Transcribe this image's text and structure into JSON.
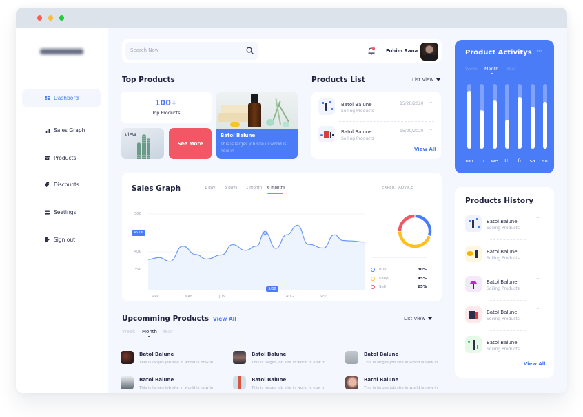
{
  "window": {
    "controls": [
      {
        "name": "close",
        "color": "#fd5f57"
      },
      {
        "name": "minimize",
        "color": "#febc2e"
      },
      {
        "name": "maximize",
        "color": "#28c840"
      }
    ]
  },
  "sidebar": {
    "items": [
      {
        "label": "Dashbord",
        "icon": "grid-icon",
        "active": true
      },
      {
        "label": "Sales Graph",
        "icon": "bar-chart-icon",
        "active": false
      },
      {
        "label": "Products",
        "icon": "box-icon",
        "active": false
      },
      {
        "label": "Discounts",
        "icon": "tag-icon",
        "active": false
      },
      {
        "label": "Seetings",
        "icon": "settings-icon",
        "active": false
      },
      {
        "label": "Sign out",
        "icon": "sign-out-icon",
        "active": false
      }
    ]
  },
  "topbar": {
    "search_placeholder": "Search Now",
    "user_name": "Fohim Rana",
    "notification_dot_color": "#f25766"
  },
  "top_products": {
    "title": "Top Products",
    "count": "100+",
    "count_label": "Top Products",
    "view_label": "View",
    "see_more_label": "See More",
    "feature": {
      "title": "Batol Balune",
      "desc": "This is larges job site in world is now in"
    }
  },
  "products_list": {
    "title": "Products List",
    "view_mode": "List View",
    "items": [
      {
        "title": "Batol Balune",
        "subtitle": "Soiling Products",
        "date": "15/20/2020"
      },
      {
        "title": "Batol Balune",
        "subtitle": "Soiling Products",
        "date": "15/20/2020"
      }
    ],
    "view_all": "View All"
  },
  "sales_graph": {
    "title": "Sales Graph",
    "tabs": [
      "1 day",
      "5 days",
      "1 month",
      "6 months"
    ],
    "active_tab": "6 months",
    "highlight": {
      "value_label": "45.0€",
      "date_label": "5/08"
    },
    "expert_advice": {
      "title": "EXPERT ADVICE",
      "legend": [
        {
          "name": "Buy",
          "pct": "30%",
          "color": "#4a7cf7"
        },
        {
          "name": "Keep",
          "pct": "45%",
          "color": "#ffc01e"
        },
        {
          "name": "Sell",
          "pct": "25%",
          "color": "#f25766"
        }
      ]
    }
  },
  "chart_data": [
    {
      "type": "area",
      "title": "Sales Graph",
      "xlabel": "",
      "ylabel": "",
      "x_ticks": [
        "APR",
        "MAY",
        "JUN",
        "AUG",
        "SEP"
      ],
      "y_ticks": [
        "50€",
        "40€",
        "35€"
      ],
      "ylim": [
        30,
        50
      ],
      "grid": true,
      "series": [
        {
          "name": "Sales",
          "x": [
            0,
            0.05,
            0.1,
            0.16,
            0.22,
            0.27,
            0.34,
            0.39,
            0.45,
            0.5,
            0.54,
            0.59,
            0.64,
            0.69,
            0.74,
            0.81,
            0.86,
            0.9,
            0.93,
            1.0
          ],
          "values": [
            38.0,
            38.5,
            37.5,
            41.5,
            39.3,
            38.1,
            39.2,
            41.9,
            40.4,
            41.5,
            45.2,
            40.9,
            44.5,
            47.0,
            42.0,
            41.0,
            44.5,
            43.0,
            42.9,
            42.6
          ]
        }
      ],
      "highlight_point": {
        "x_label": "5/08",
        "value": 45.0
      }
    },
    {
      "type": "pie",
      "title": "EXPERT ADVICE",
      "categories": [
        "Buy",
        "Keep",
        "Sell"
      ],
      "values": [
        30,
        45,
        25
      ]
    },
    {
      "type": "bar",
      "title": "Product Activitys",
      "categories": [
        "mo",
        "tu",
        "we",
        "th",
        "fr",
        "sa",
        "su"
      ],
      "values": [
        0.89,
        0.6,
        0.74,
        0.45,
        0.8,
        0.65,
        0.72
      ],
      "ylim": [
        0,
        1
      ]
    }
  ],
  "upcoming": {
    "title": "Upcomming Products",
    "view_all": "View All",
    "view_mode": "List View",
    "tabs": [
      "Week",
      "Month",
      "Year"
    ],
    "active_tab": "Month",
    "items": [
      {
        "title": "Batol Balune",
        "desc": "This is larges job site in world is now in"
      },
      {
        "title": "Batol Balune",
        "desc": "This is larges job site in world is now in"
      },
      {
        "title": "Batol Balune",
        "desc": "This is larges job site in world is now in"
      },
      {
        "title": "Batol Balune",
        "desc": "This is larges job site in world is now in"
      },
      {
        "title": "Batol Balune",
        "desc": "This is larges job site in world is now in"
      },
      {
        "title": "Batol Balune",
        "desc": "This is larges job site in world is now in"
      }
    ]
  },
  "activity": {
    "title": "Product Activitys",
    "tabs": [
      "Week",
      "Month",
      "Year"
    ],
    "active_tab": "Month"
  },
  "history": {
    "title": "Products History",
    "items": [
      {
        "title": "Batol Balune",
        "subtitle": "Soiling Products",
        "accent": "#eef2fe"
      },
      {
        "title": "Batol Balune",
        "subtitle": "Soiling Products",
        "accent": "#fff6e0"
      },
      {
        "title": "Batol Balune",
        "subtitle": "Soiling Products",
        "accent": "#f6e8fb"
      },
      {
        "title": "Batol Balune",
        "subtitle": "Soiling Products",
        "accent": "#fde9ec"
      },
      {
        "title": "Batol Balune",
        "subtitle": "Soiling Products",
        "accent": "#e6f8e8"
      }
    ],
    "view_all": "View All"
  }
}
